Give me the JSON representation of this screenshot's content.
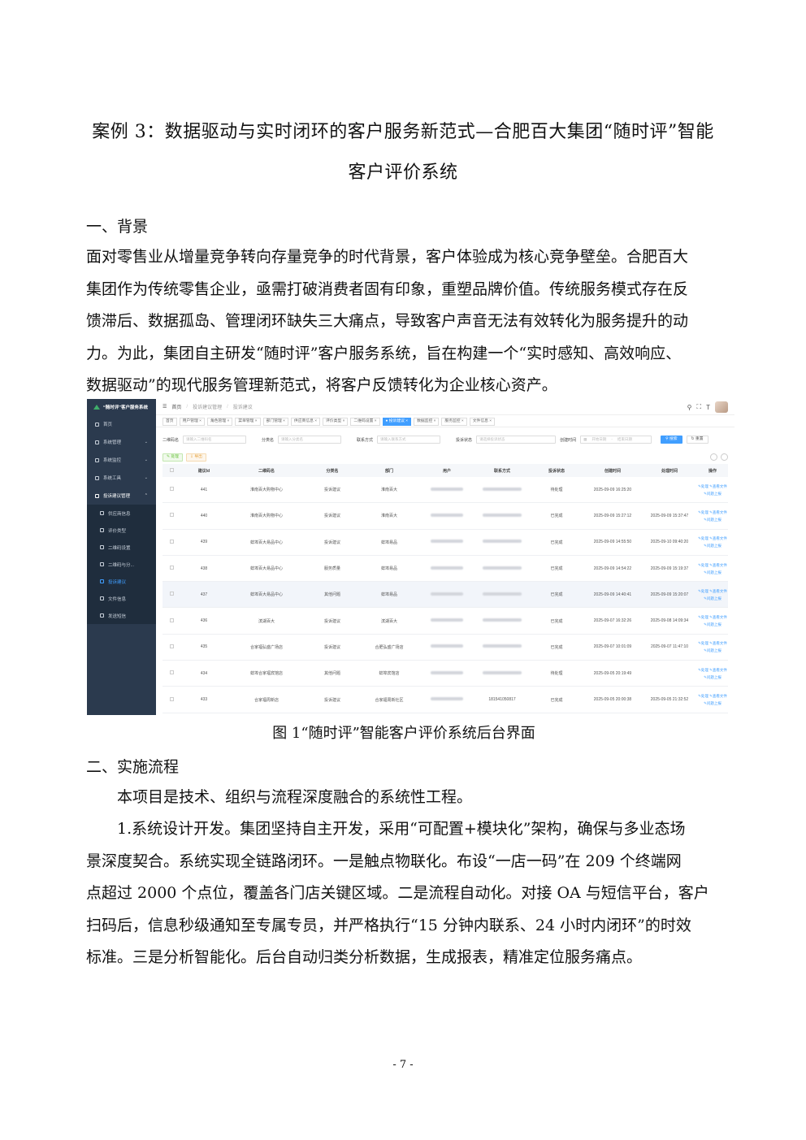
{
  "doc": {
    "title_line1": "案例 3：数据驱动与实时闭环的客户服务新范式—合肥百大集团“随时评”智能",
    "title_line2": "客户评价系统",
    "section1_heading": "一、背景",
    "section1_lines": [
      "面对零售业从增量竞争转向存量竞争的时代背景，客户体验成为核心竞争壁垒。合肥百大",
      "集团作为传统零售企业，亟需打破消费者固有印象，重塑品牌价值。传统服务模式存在反",
      "馈滞后、数据孤岛、管理闭环缺失三大痛点，导致客户声音无法有效转化为服务提升的动",
      "力。为此，集团自主研发“随时评”客户服务系统，旨在构建一个“实时感知、高效响应、",
      "数据驱动”的现代服务管理新范式，将客户反馈转化为企业核心资产。"
    ],
    "figure_caption": "图 1“随时评”智能客户评价系统后台界面",
    "section2_heading": "二、实施流程",
    "section2_intro": "本项目是技术、组织与流程深度融合的系统性工程。",
    "section2_lines": [
      "1.系统设计开发。集团坚持自主开发，采用“可配置+模块化”架构，确保与多业态场",
      "景深度契合。系统实现全链路闭环。一是触点物联化。布设“一店一码”在 209 个终端网",
      "点超过 2000 个点位，覆盖各门店关键区域。二是流程自动化。对接 OA 与短信平台，客户",
      "扫码后，信息秒级通知至专属专员，并严格执行“15 分钟内联系、24 小时内闭环”的时效",
      "标准。三是分析智能化。后台自动归类分析数据，生成报表，精准定位服务痛点。"
    ],
    "page_number": "- 7 -"
  },
  "screenshot": {
    "brand": "“随时评”客户服务系统",
    "sidebar": {
      "top_items": [
        "首页",
        "系统管理",
        "系统监控",
        "系统工具",
        "投诉建议管理"
      ],
      "sub_items": [
        "供应商信息",
        "评价类型",
        "二维码设置",
        "二维码与分...",
        "投诉建议",
        "文件信息",
        "发送短信"
      ],
      "active_sub": "投诉建议"
    },
    "breadcrumb": [
      "首页",
      "投诉建议管理",
      "投诉建议"
    ],
    "tags": [
      "首页",
      "用户管理 ×",
      "角色管理 ×",
      "菜单管理 ×",
      "部门管理 ×",
      "供应商信息 ×",
      "评价类型 ×",
      "二维码设置 ×",
      "● 投诉建议 ×",
      "数据监控 ×",
      "服务监控 ×",
      "文件信息 ×"
    ],
    "active_tag": "● 投诉建议 ×",
    "filters": {
      "qrcode_label": "二维码名",
      "qrcode_placeholder": "请输入二维码名",
      "category_label": "分类名",
      "category_placeholder": "请输入分类名",
      "contact_label": "联系方式",
      "contact_placeholder": "请输入联系方式",
      "status_label": "投诉状态",
      "status_placeholder": "请选择投诉状态",
      "created_label": "创建时间",
      "start_placeholder": "开始日期",
      "range_sep": "-",
      "end_placeholder": "结束日期",
      "search_button": "搜索",
      "reset_button": "重置"
    },
    "action_buttons": {
      "process": "处理",
      "export": "导出"
    },
    "table": {
      "headers": [
        "",
        "建议Id",
        "二维码名",
        "分类名",
        "部门",
        "用户",
        "联系方式",
        "投诉状态",
        "创建时间",
        "处理时间",
        "操作"
      ],
      "op_labels": {
        "process": "处理",
        "view_file": "查看文件",
        "upload": "问题上报"
      },
      "rows": [
        {
          "id": "441",
          "qrcode": "淮南百大购物中心",
          "category": "投诉建议",
          "dept": "淮南百大",
          "contact": "",
          "status": "待处理",
          "created": "2025-09-09 16:25:20",
          "handled": ""
        },
        {
          "id": "440",
          "qrcode": "淮南百大购物中心",
          "category": "投诉建议",
          "dept": "淮南百大",
          "contact": "",
          "status": "已完成",
          "created": "2025-09-09 15:27:12",
          "handled": "2025-09-09 15:37:47"
        },
        {
          "id": "439",
          "qrcode": "蚌埠百大易品中心",
          "category": "投诉建议",
          "dept": "蚌埠易品",
          "contact": "",
          "status": "已完成",
          "created": "2025-09-09 14:55:50",
          "handled": "2025-09-10 09:40:20"
        },
        {
          "id": "438",
          "qrcode": "蚌埠百大易品中心",
          "category": "服务质量",
          "dept": "蚌埠易品",
          "contact": "",
          "status": "已完成",
          "created": "2025-09-09 14:54:22",
          "handled": "2025-09-09 15:19:37"
        },
        {
          "id": "437",
          "qrcode": "蚌埠百大易品中心",
          "category": "其他问题",
          "dept": "蚌埠易品",
          "contact": "",
          "status": "已完成",
          "created": "2025-09-09 14:40:41",
          "handled": "2025-09-09 15:20:07"
        },
        {
          "id": "436",
          "qrcode": "滨湖百大",
          "category": "投诉建议",
          "dept": "滨湖百大",
          "contact": "",
          "status": "已完成",
          "created": "2025-09-07 16:32:26",
          "handled": "2025-09-08 14:09:34"
        },
        {
          "id": "435",
          "qrcode": "合家福弘盛广场店",
          "category": "投诉建议",
          "dept": "合肥弘盛广场店",
          "contact": "",
          "status": "已完成",
          "created": "2025-09-07 10:01:09",
          "handled": "2025-09-07 11:47:10"
        },
        {
          "id": "434",
          "qrcode": "蚌埠合家福宾馆店",
          "category": "其他问题",
          "dept": "蚌埠宾馆店",
          "contact": "",
          "status": "待处理",
          "created": "2025-09-05 20:19:49",
          "handled": ""
        },
        {
          "id": "433",
          "qrcode": "合家福周新店",
          "category": "投诉建议",
          "dept": "合家福周新社区",
          "contact": "181541050817",
          "status": "已完成",
          "created": "2025-09-05 20:00:38",
          "handled": "2025-09-05 21:32:52"
        }
      ]
    }
  }
}
